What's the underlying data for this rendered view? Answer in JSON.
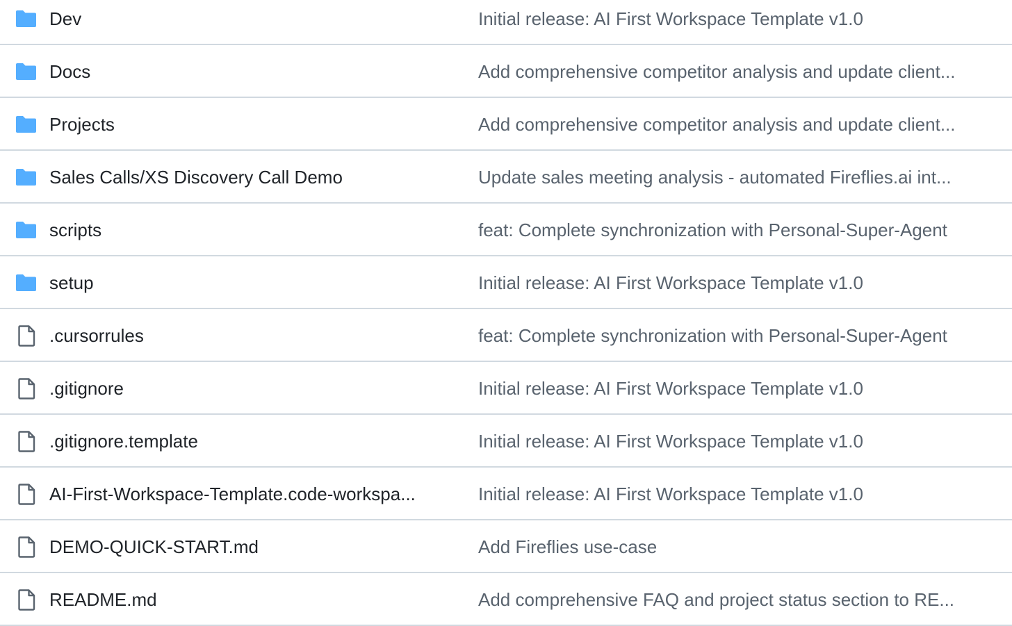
{
  "colors": {
    "folder_icon": "#54aeff",
    "file_icon": "#59636e",
    "name_text": "#1f2328",
    "commit_text": "#59636e",
    "divider": "#d1d9e0"
  },
  "rows": [
    {
      "type": "folder",
      "icon": "folder-icon",
      "name": "Dev",
      "commit": "Initial release: AI First Workspace Template v1.0"
    },
    {
      "type": "folder",
      "icon": "folder-icon",
      "name": "Docs",
      "commit": "Add comprehensive competitor analysis and update client..."
    },
    {
      "type": "folder",
      "icon": "folder-icon",
      "name": "Projects",
      "commit": "Add comprehensive competitor analysis and update client..."
    },
    {
      "type": "folder",
      "icon": "folder-icon",
      "name": "Sales Calls/XS Discovery Call Demo",
      "commit": "Update sales meeting analysis - automated Fireflies.ai int..."
    },
    {
      "type": "folder",
      "icon": "folder-icon",
      "name": "scripts",
      "commit": "feat: Complete synchronization with Personal-Super-Agent"
    },
    {
      "type": "folder",
      "icon": "folder-icon",
      "name": "setup",
      "commit": "Initial release: AI First Workspace Template v1.0"
    },
    {
      "type": "file",
      "icon": "file-icon",
      "name": ".cursorrules",
      "commit": "feat: Complete synchronization with Personal-Super-Agent"
    },
    {
      "type": "file",
      "icon": "file-icon",
      "name": ".gitignore",
      "commit": "Initial release: AI First Workspace Template v1.0"
    },
    {
      "type": "file",
      "icon": "file-icon",
      "name": ".gitignore.template",
      "commit": "Initial release: AI First Workspace Template v1.0"
    },
    {
      "type": "file",
      "icon": "file-icon",
      "name": "AI-First-Workspace-Template.code-workspa...",
      "commit": "Initial release: AI First Workspace Template v1.0"
    },
    {
      "type": "file",
      "icon": "file-icon",
      "name": "DEMO-QUICK-START.md",
      "commit": "Add Fireflies use-case"
    },
    {
      "type": "file",
      "icon": "file-icon",
      "name": "README.md",
      "commit": "Add comprehensive FAQ and project status section to RE..."
    }
  ]
}
